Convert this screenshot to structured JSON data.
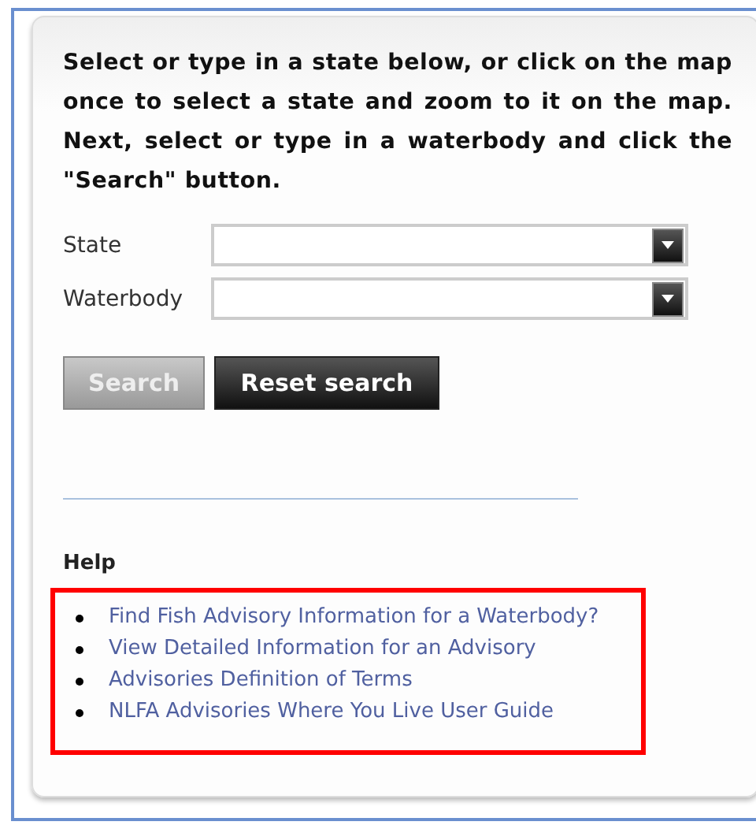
{
  "instructions": "Select or type in a state below, or click on the map once to select a state and zoom to it on the map. Next, select or type in a waterbody and click the \"Search\" button.",
  "fields": [
    {
      "label": "State"
    },
    {
      "label": "Waterbody"
    }
  ],
  "buttons": [
    {
      "label": "Search",
      "kind": "primary",
      "disabled": true
    },
    {
      "label": "Reset search",
      "kind": "reset",
      "disabled": false
    }
  ],
  "help": {
    "title": "Help",
    "highlighted": true,
    "links": [
      {
        "label": "Find Fish Advisory Information for a Waterbody?"
      },
      {
        "label": "View Detailed Information for an Advisory"
      },
      {
        "label": "Advisories Definition of Terms"
      },
      {
        "label": "NLFA Advisories Where You Live User Guide"
      }
    ]
  }
}
